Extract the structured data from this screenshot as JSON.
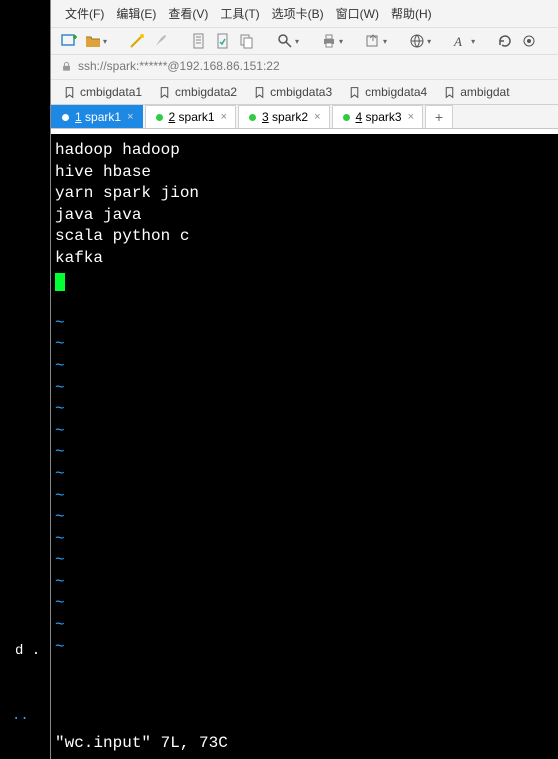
{
  "menu": {
    "file": "文件(F)",
    "edit": "编辑(E)",
    "view": "查看(V)",
    "tools": "工具(T)",
    "tabs": "选项卡(B)",
    "window": "窗口(W)",
    "help": "帮助(H)"
  },
  "address": {
    "url": "ssh://spark:******@192.168.86.151:22"
  },
  "bookmarks": [
    {
      "label": "cmbigdata1"
    },
    {
      "label": "cmbigdata2"
    },
    {
      "label": "cmbigdata3"
    },
    {
      "label": "cmbigdata4"
    },
    {
      "label": "ambigdat"
    }
  ],
  "tabs": [
    {
      "num": "1",
      "label": "spark1",
      "active": true
    },
    {
      "num": "2",
      "label": "spark1",
      "active": false
    },
    {
      "num": "3",
      "label": "spark2",
      "active": false
    },
    {
      "num": "4",
      "label": "spark3",
      "active": false
    }
  ],
  "tab_add": "+",
  "terminal": {
    "lines": [
      "hadoop hadoop",
      "hive hbase",
      "yarn spark jion",
      "java java",
      "scala python c",
      "kafka"
    ],
    "tilde": "~",
    "tilde_count": 16,
    "status": "\"wc.input\" 7L, 73C"
  },
  "leftstrip": {
    "d": "d .",
    "dots": "..",
    "ls": ""
  }
}
